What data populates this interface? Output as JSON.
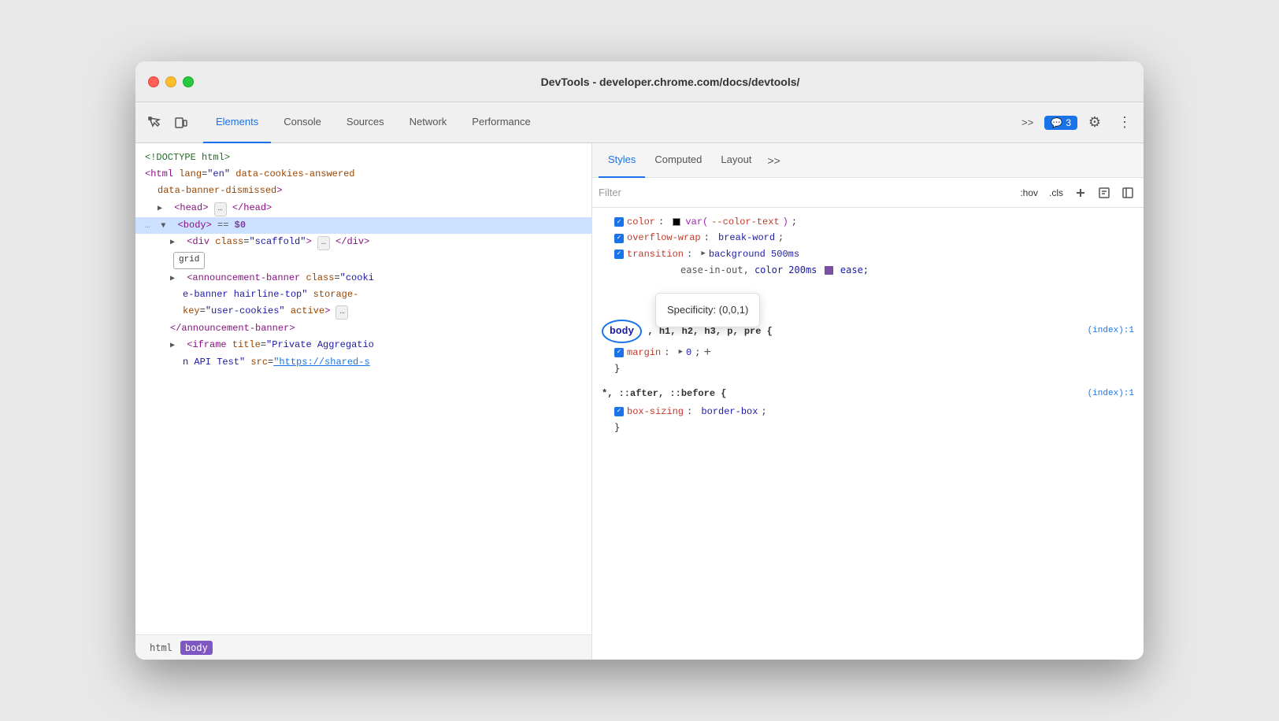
{
  "window": {
    "title": "DevTools - developer.chrome.com/docs/devtools/"
  },
  "toolbar": {
    "tabs": [
      {
        "label": "Elements",
        "active": true
      },
      {
        "label": "Console",
        "active": false
      },
      {
        "label": "Sources",
        "active": false
      },
      {
        "label": "Network",
        "active": false
      },
      {
        "label": "Performance",
        "active": false
      }
    ],
    "more_tabs_label": ">>",
    "notification_icon": "💬",
    "notification_count": "3",
    "settings_icon": "⚙",
    "more_icon": "⋮"
  },
  "dom_tree": {
    "lines": [
      {
        "text": "<!DOCTYPE html>",
        "indent": 0,
        "type": "comment"
      },
      {
        "text": "<html lang=\"en\" data-cookies-answered",
        "indent": 0,
        "type": "tag"
      },
      {
        "text": "data-banner-dismissed>",
        "indent": 1,
        "type": "tag-cont"
      },
      {
        "text": "▶ <head>…</head>",
        "indent": 1,
        "type": "collapsed"
      },
      {
        "text": "… ▼ <body> == $0",
        "indent": 0,
        "type": "selected-line"
      },
      {
        "text": "▶ <div class=\"scaffold\">…</div>",
        "indent": 2,
        "type": "div-scaffold"
      },
      {
        "text": "grid",
        "indent": 2,
        "type": "badge"
      },
      {
        "text": "▶ <announcement-banner class=\"cooki",
        "indent": 2,
        "type": "announcement1"
      },
      {
        "text": "e-banner hairline-top\" storage-",
        "indent": 3,
        "type": "announcement2"
      },
      {
        "text": "key=\"user-cookies\" active>…",
        "indent": 3,
        "type": "announcement3"
      },
      {
        "text": "</announcement-banner>",
        "indent": 2,
        "type": "announcement4"
      },
      {
        "text": "▶ <iframe title=\"Private Aggregatio",
        "indent": 2,
        "type": "iframe1"
      },
      {
        "text": "n API Test\" src=\"https://shared-s",
        "indent": 3,
        "type": "iframe2"
      }
    ]
  },
  "breadcrumb": {
    "items": [
      {
        "label": "html",
        "active": false
      },
      {
        "label": "body",
        "active": true
      }
    ]
  },
  "styles_panel": {
    "tabs": [
      {
        "label": "Styles",
        "active": true
      },
      {
        "label": "Computed",
        "active": false
      },
      {
        "label": "Layout",
        "active": false
      },
      {
        "label": ">>",
        "active": false
      }
    ],
    "filter_placeholder": "Filter",
    "filter_buttons": [
      {
        "label": ":hov"
      },
      {
        "label": ".cls"
      }
    ],
    "css_rules": [
      {
        "selector_parts": [
          "color"
        ],
        "property": "color",
        "value": "var(--color-text)",
        "has_swatch": true,
        "swatch_color": "#000000"
      },
      {
        "property": "overflow-wrap",
        "value": "break-word"
      },
      {
        "property": "transition",
        "value": "background 500ms ease-in-out, color 200ms ease"
      }
    ],
    "specificity_tooltip": "Specificity: (0,0,1)",
    "rule_body_selector": "body, h1, h2, h3, p, pre {",
    "rule_body_file": "(index):1",
    "margin_property": "margin",
    "margin_value": "0",
    "rule_universal_selector": "*, ::after, ::before {",
    "rule_universal_file": "(index):1",
    "box_sizing_property": "box-sizing",
    "box_sizing_value": "border-box"
  }
}
